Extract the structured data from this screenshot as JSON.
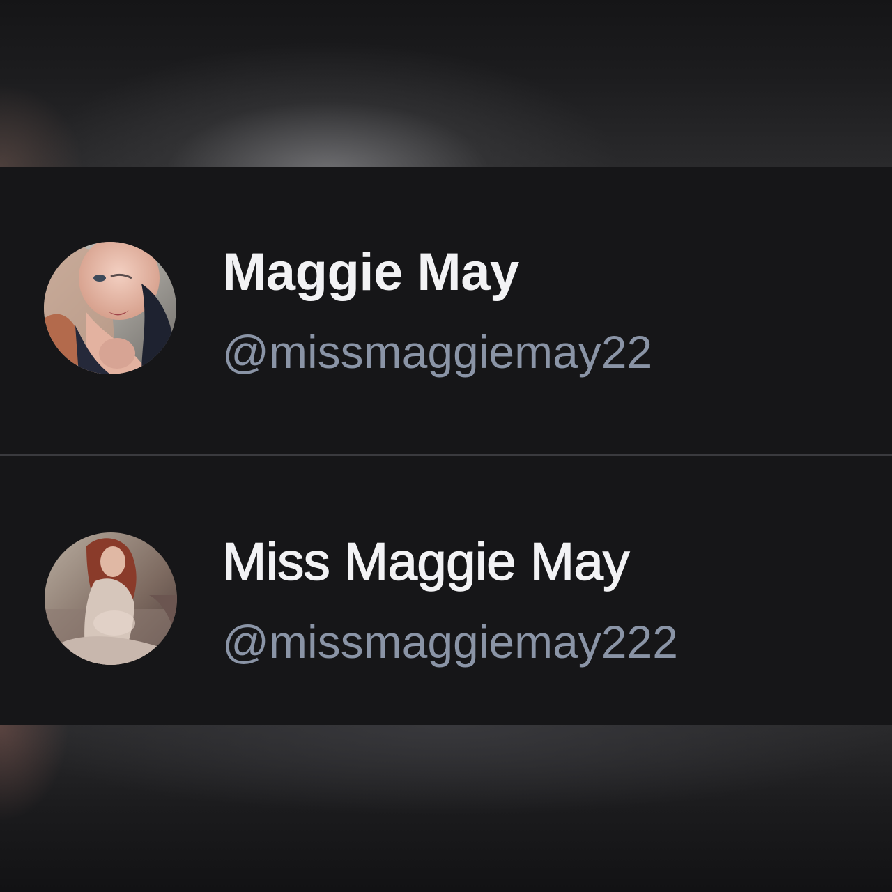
{
  "accounts": [
    {
      "display_name": "Maggie May",
      "handle": "@missmaggiemay22",
      "avatar_icon": "profile-photo"
    },
    {
      "display_name": "Miss Maggie May",
      "handle": "@missmaggiemay222",
      "avatar_icon": "profile-photo"
    }
  ],
  "colors": {
    "card_background": "#161618",
    "name_text": "#f2f2f4",
    "handle_text": "#8a94a6",
    "divider": "#3a3a3e"
  }
}
